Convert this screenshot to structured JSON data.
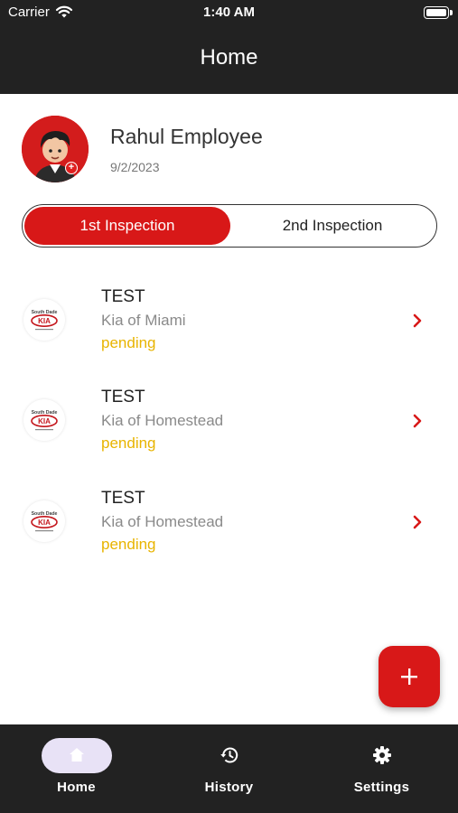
{
  "status_bar": {
    "carrier": "Carrier",
    "time": "1:40 AM"
  },
  "header": {
    "title": "Home"
  },
  "profile": {
    "name": "Rahul Employee",
    "date": "9/2/2023"
  },
  "tabs": [
    {
      "label": "1st Inspection",
      "active": true
    },
    {
      "label": "2nd Inspection",
      "active": false
    }
  ],
  "inspections": [
    {
      "title": "TEST",
      "dealer": "Kia of Miami",
      "status": "pending"
    },
    {
      "title": "TEST",
      "dealer": "Kia of Homestead",
      "status": "pending"
    },
    {
      "title": "TEST",
      "dealer": "Kia of Homestead",
      "status": "pending"
    }
  ],
  "logo": {
    "top_text": "South Dade",
    "brand": "KIA"
  },
  "bottom_nav": [
    {
      "label": "Home",
      "icon": "home-icon",
      "active": true
    },
    {
      "label": "History",
      "icon": "history-icon",
      "active": false
    },
    {
      "label": "Settings",
      "icon": "gear-icon",
      "active": false
    }
  ],
  "colors": {
    "accent": "#d81818",
    "pending": "#e8b400",
    "bar": "#222222",
    "nav_active_pill": "#e8e2f6"
  }
}
